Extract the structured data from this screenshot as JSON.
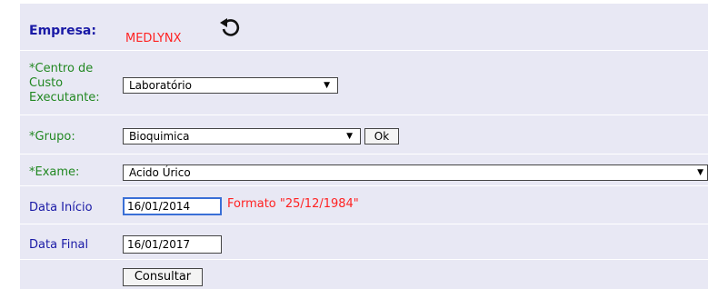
{
  "company": {
    "label": "Empresa:",
    "value": "MEDLYNX",
    "refresh_icon": "refresh-icon"
  },
  "cost_center": {
    "label_lines": [
      "*Centro de",
      "Custo",
      "Executante:"
    ],
    "value": "Laboratório"
  },
  "group": {
    "label": "*Grupo:",
    "value": "Bioquimica",
    "ok_label": "Ok"
  },
  "exam": {
    "label": "*Exame:",
    "value": "Acido Úrico"
  },
  "start_date": {
    "label": "Data Início",
    "value": "16/01/2014",
    "format_hint": "Formato \"25/12/1984\""
  },
  "end_date": {
    "label": "Data Final",
    "value": "16/01/2017"
  },
  "submit": {
    "label": "Consultar"
  },
  "colors": {
    "label_green": "#228822",
    "label_blue": "#1a1aa6",
    "accent_red": "#ff2222",
    "panel_bg": "#e8e8f4"
  }
}
